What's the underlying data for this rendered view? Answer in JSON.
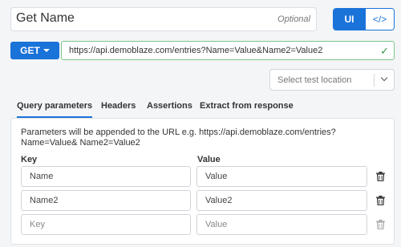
{
  "header": {
    "name": "Get Name",
    "optional_label": "Optional",
    "toggle": {
      "ui_label": "UI",
      "code_label": "</>"
    }
  },
  "request": {
    "method": "GET",
    "url": "https://api.demoblaze.com/entries?Name=Value&Name2=Value2",
    "valid_icon": "check-icon"
  },
  "location": {
    "placeholder": "Select test location"
  },
  "tabs": [
    {
      "label": "Query parameters",
      "active": true
    },
    {
      "label": "Headers",
      "active": false
    },
    {
      "label": "Assertions",
      "active": false
    },
    {
      "label": "Extract from response",
      "active": false
    }
  ],
  "params": {
    "info": "Parameters will be appended to the URL e.g. https://api.demoblaze.com/entries?Name=Value& Name2=Value2",
    "key_header": "Key",
    "value_header": "Value",
    "rows": [
      {
        "key": "Name",
        "value": "Value"
      },
      {
        "key": "Name2",
        "value": "Value2"
      }
    ],
    "empty_row": {
      "key_placeholder": "Key",
      "value_placeholder": "Value"
    }
  },
  "colors": {
    "accent": "#1a73d9",
    "valid": "#2e9b45"
  }
}
